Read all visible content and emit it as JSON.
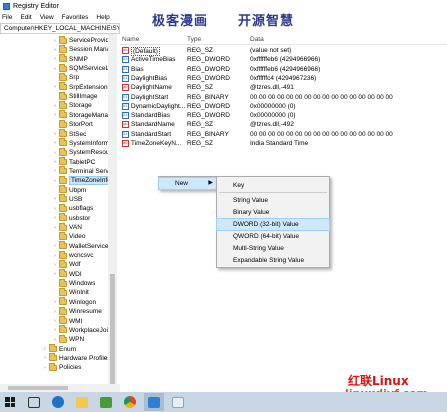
{
  "window": {
    "title": "Registry Editor"
  },
  "menu": [
    "File",
    "Edit",
    "View",
    "Favorites",
    "Help"
  ],
  "address": "Computer\\HKEY_LOCAL_MACHINE\\SYSTEM\\",
  "watermark_top": {
    "left": "极客漫画",
    "right": "开源智慧"
  },
  "tree": [
    {
      "label": "ServiceProvide",
      "exp": "›"
    },
    {
      "label": "Session Manag",
      "exp": "›"
    },
    {
      "label": "SNMP",
      "exp": "›"
    },
    {
      "label": "SQMServiceLi",
      "exp": "›"
    },
    {
      "label": "Srp",
      "exp": ""
    },
    {
      "label": "SrpExtensionC",
      "exp": "›"
    },
    {
      "label": "StillImage",
      "exp": ""
    },
    {
      "label": "Storage",
      "exp": "›"
    },
    {
      "label": "StorageManag",
      "exp": "›"
    },
    {
      "label": "StorPort",
      "exp": ""
    },
    {
      "label": "StSec",
      "exp": "›"
    },
    {
      "label": "SystemInform",
      "exp": "›"
    },
    {
      "label": "SystemResour",
      "exp": "›"
    },
    {
      "label": "TabletPC",
      "exp": "›"
    },
    {
      "label": "Terminal Serve",
      "exp": "›"
    },
    {
      "label": "TimeZoneInfo",
      "exp": "›",
      "selected": true
    },
    {
      "label": "Ubpm",
      "exp": ""
    },
    {
      "label": "USB",
      "exp": "›"
    },
    {
      "label": "usbflags",
      "exp": "›"
    },
    {
      "label": "usbstor",
      "exp": "›"
    },
    {
      "label": "VAN",
      "exp": "›"
    },
    {
      "label": "Video",
      "exp": ""
    },
    {
      "label": "WalletService",
      "exp": "›"
    },
    {
      "label": "wcncsvc",
      "exp": "›"
    },
    {
      "label": "Wdf",
      "exp": "›"
    },
    {
      "label": "WDI",
      "exp": "›"
    },
    {
      "label": "Windows",
      "exp": ""
    },
    {
      "label": "WinInit",
      "exp": ""
    },
    {
      "label": "Winlogon",
      "exp": "›"
    },
    {
      "label": "Winresume",
      "exp": "›"
    },
    {
      "label": "WMI",
      "exp": "›"
    },
    {
      "label": "WorkplaceJoin",
      "exp": "›"
    },
    {
      "label": "WPN",
      "exp": "›"
    },
    {
      "label": "Enum",
      "exp": "›",
      "level": 1
    },
    {
      "label": "Hardware Profiles",
      "exp": "›",
      "level": 1
    },
    {
      "label": "Policies",
      "exp": "›",
      "level": 1
    }
  ],
  "columns": {
    "name": "Name",
    "type": "Type",
    "data": "Data"
  },
  "values": [
    {
      "name": "(Default)",
      "type": "REG_SZ",
      "data": "(value not set)",
      "icon": "sz",
      "boxed": true
    },
    {
      "name": "ActiveTimeBias",
      "type": "REG_DWORD",
      "data": "0xffffffeb6 (4294966966)",
      "icon": "bin"
    },
    {
      "name": "Bias",
      "type": "REG_DWORD",
      "data": "0xffffffeb6 (4294966966)",
      "icon": "bin"
    },
    {
      "name": "DaylightBias",
      "type": "REG_DWORD",
      "data": "0xffffffc4 (4294967236)",
      "icon": "bin"
    },
    {
      "name": "DaylightName",
      "type": "REG_SZ",
      "data": "@tzres.dll,-491",
      "icon": "sz"
    },
    {
      "name": "DaylightStart",
      "type": "REG_BINARY",
      "data": "00 00 00 00 00 00 00 00 00 00 00 00 00 00 00 00",
      "icon": "bin"
    },
    {
      "name": "DynamicDaylight...",
      "type": "REG_DWORD",
      "data": "0x00000000 (0)",
      "icon": "bin"
    },
    {
      "name": "StandardBias",
      "type": "REG_DWORD",
      "data": "0x00000000 (0)",
      "icon": "bin"
    },
    {
      "name": "StandardName",
      "type": "REG_SZ",
      "data": "@tzres.dll,-492",
      "icon": "sz"
    },
    {
      "name": "StandardStart",
      "type": "REG_BINARY",
      "data": "00 00 00 00 00 00 00 00 00 00 00 00 00 00 00 00",
      "icon": "bin"
    },
    {
      "name": "TimeZoneKeyN...",
      "type": "REG_SZ",
      "data": "India Standard Time",
      "icon": "sz"
    }
  ],
  "context_menu": {
    "new_label": "New"
  },
  "submenu": [
    "Key",
    "String Value",
    "Binary Value",
    "DWORD (32-bit) Value",
    "QWORD (64-bit) Value",
    "Multi-String Value",
    "Expandable String Value"
  ],
  "submenu_highlight_index": 3,
  "watermark_bottom": {
    "line1": "红联Linux",
    "line2": "linuxdiyf.com"
  },
  "taskbar": [
    "windows-start",
    "task-view",
    "edge",
    "file-explorer",
    "store",
    "chrome",
    "regedit",
    "media"
  ]
}
